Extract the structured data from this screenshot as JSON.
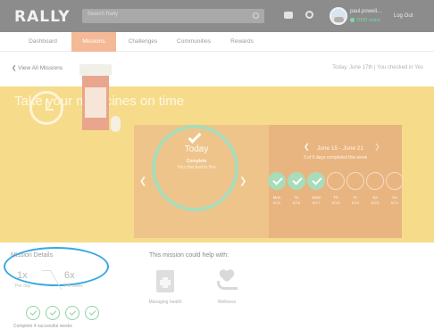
{
  "header": {
    "logo": "RALLY",
    "search_placeholder": "Search Rally",
    "username": "paul.powell...",
    "coins": "7000 coins",
    "logout": "Log Out",
    "icons": [
      "chat-icon",
      "gear-icon",
      "avatar"
    ]
  },
  "nav": {
    "tabs": [
      {
        "label": "Dashboard",
        "active": false
      },
      {
        "label": "Missions",
        "active": true
      },
      {
        "label": "Challenges",
        "active": false
      },
      {
        "label": "Communities",
        "active": false
      },
      {
        "label": "Rewards",
        "active": false
      }
    ]
  },
  "subheader": {
    "back": "View All Missions",
    "checkin": "Today, June 17th | You checked in Yes"
  },
  "mission": {
    "title": "Take your medicines on time",
    "today_label": "Today",
    "today_status": "Complete",
    "today_sub": "You checked in Yes"
  },
  "week": {
    "range": "June 15 - June 21",
    "progress": "3 of 6 days completed this week",
    "days": [
      {
        "name": "Mon",
        "date": "6/15",
        "done": true
      },
      {
        "name": "Tu",
        "date": "6/16",
        "done": true
      },
      {
        "name": "Wed",
        "date": "6/17",
        "done": true
      },
      {
        "name": "Th",
        "date": "6/18",
        "done": false
      },
      {
        "name": "Fr",
        "date": "6/19",
        "done": false
      },
      {
        "name": "Sa",
        "date": "6/20",
        "done": false
      },
      {
        "name": "Su",
        "date": "6/21",
        "done": false
      }
    ]
  },
  "details": {
    "title": "Mission Details",
    "per_day_value": "1x",
    "per_day_label": "Per day",
    "per_week_value": "6x",
    "per_week_label": "Per week",
    "complete_text": "Complete 4 successful weeks"
  },
  "help": {
    "title": "This mission could help with:",
    "items": [
      {
        "label": "Managing health",
        "icon": "health-icon"
      },
      {
        "label": "Wellness",
        "icon": "wellness-icon"
      }
    ]
  },
  "colors": {
    "topbar": "#8c8c8c",
    "hero": "#f6dc8a",
    "nav_active": "#f4b997",
    "success": "#a9dcb9",
    "highlight": "#37a9e1"
  }
}
